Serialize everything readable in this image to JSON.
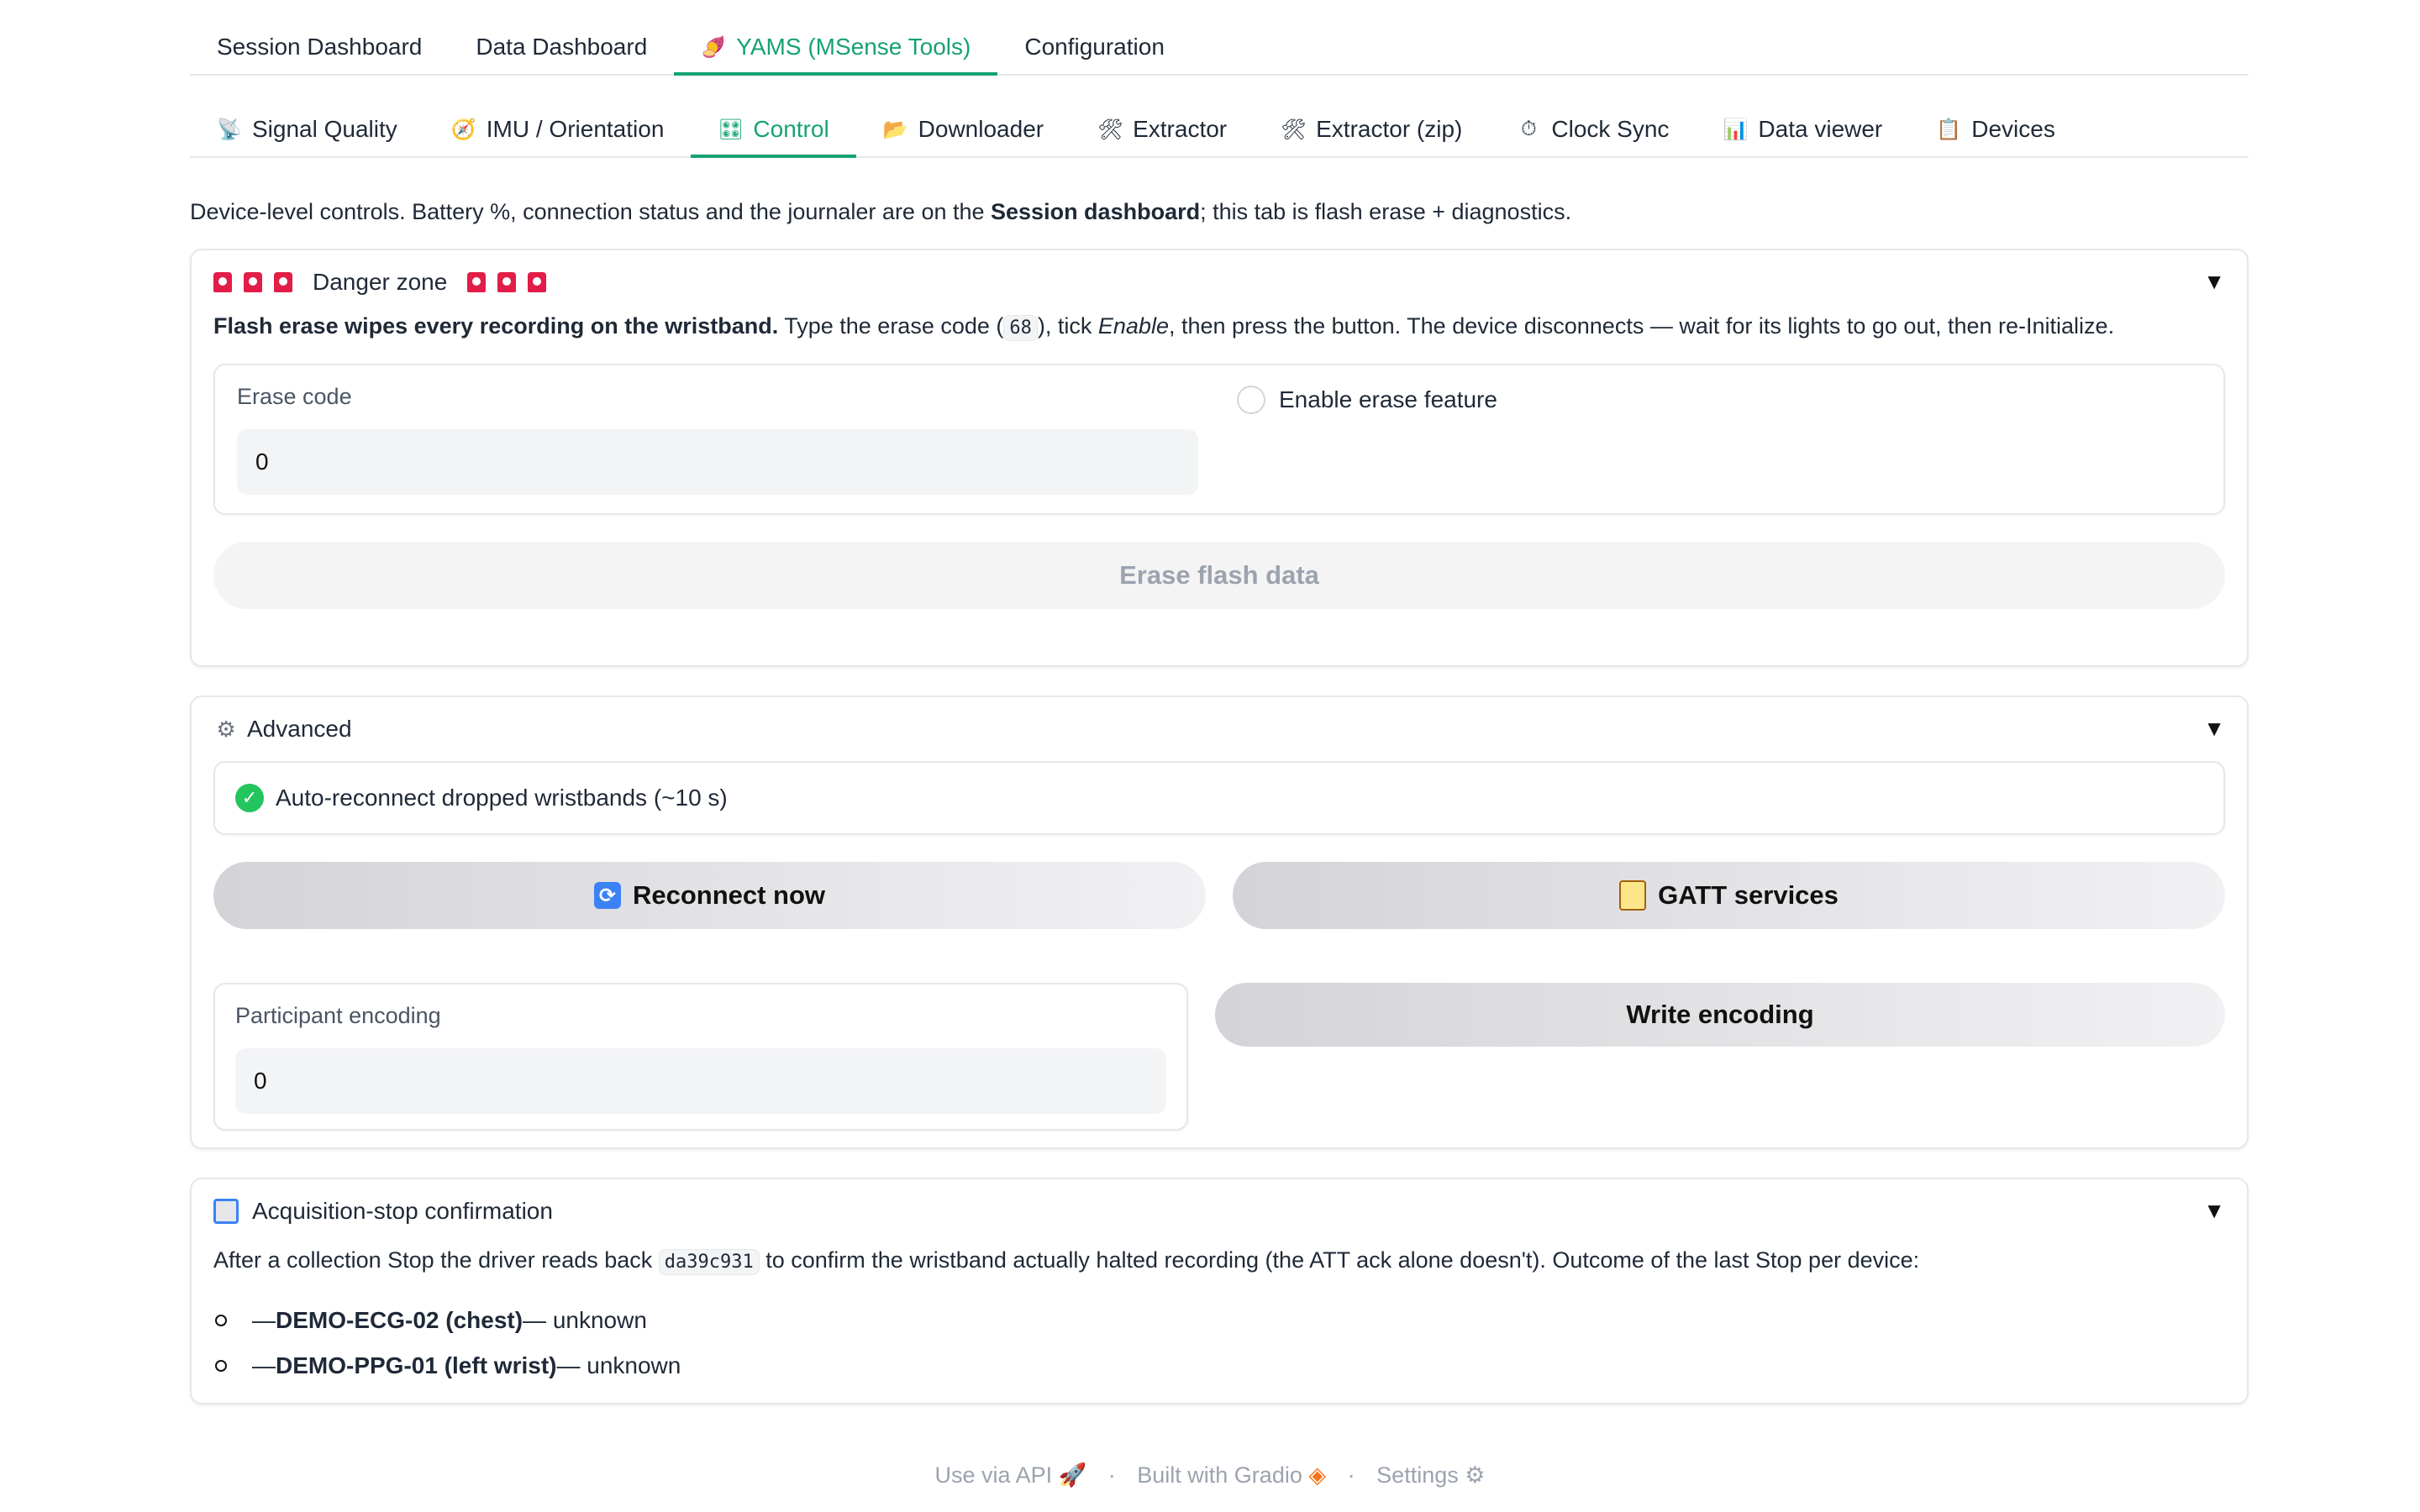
{
  "top_tabs": [
    {
      "label": "Session Dashboard",
      "icon": ""
    },
    {
      "label": "Data Dashboard",
      "icon": ""
    },
    {
      "label": "YAMS (MSense Tools)",
      "icon": "🍠"
    },
    {
      "label": "Configuration",
      "icon": ""
    }
  ],
  "top_tabs_active": 2,
  "sub_tabs": [
    {
      "label": "Signal Quality",
      "icon": "📡"
    },
    {
      "label": "IMU / Orientation",
      "icon": "🧭"
    },
    {
      "label": "Control",
      "icon": "🎛"
    },
    {
      "label": "Downloader",
      "icon": "📂"
    },
    {
      "label": "Extractor",
      "icon": "🛠"
    },
    {
      "label": "Extractor (zip)",
      "icon": "🛠"
    },
    {
      "label": "Clock Sync",
      "icon": "⏱"
    },
    {
      "label": "Data viewer",
      "icon": "📊"
    },
    {
      "label": "Devices",
      "icon": "📋"
    }
  ],
  "sub_tabs_active": 2,
  "intro": {
    "pre": "Device-level controls. Battery %, connection status and the journaler are on the ",
    "bold": "Session dashboard",
    "post": "; this tab is flash erase + diagnostics."
  },
  "danger": {
    "title": "Danger zone",
    "caret": "▼",
    "warn_bold": "Flash erase wipes every recording on the wristband.",
    "warn_pre": " Type the erase code (",
    "warn_code": "68",
    "warn_mid": "), tick ",
    "warn_em": "Enable",
    "warn_post": ", then press the button. The device disconnects — wait for its lights to go out, then re-Initialize.",
    "erase_code_label": "Erase code",
    "erase_code_value": "0",
    "enable_label": "Enable erase feature",
    "erase_button": "Erase flash data"
  },
  "advanced": {
    "title": "Advanced",
    "caret": "▼",
    "auto_reconnect": "Auto-reconnect dropped wristbands (~10 s)",
    "reconnect_button": "Reconnect now",
    "gatt_button": "GATT services",
    "encoding_label": "Participant encoding",
    "encoding_value": "0",
    "write_button": "Write encoding"
  },
  "acq": {
    "title": "Acquisition-stop confirmation",
    "caret": "▼",
    "text_pre": "After a collection Stop the driver reads back ",
    "text_code": "da39c931",
    "text_post": " to confirm the wristband actually halted recording (the ATT ack alone doesn't). Outcome of the last Stop per device:",
    "items": [
      {
        "prefix": "— ",
        "device": "DEMO-ECG-02 (chest)",
        "status": " — unknown"
      },
      {
        "prefix": "— ",
        "device": "DEMO-PPG-01 (left wrist)",
        "status": " — unknown"
      }
    ]
  },
  "footer": {
    "api": "Use via API",
    "gradio": "Built with Gradio",
    "settings": "Settings",
    "sep": "·"
  }
}
